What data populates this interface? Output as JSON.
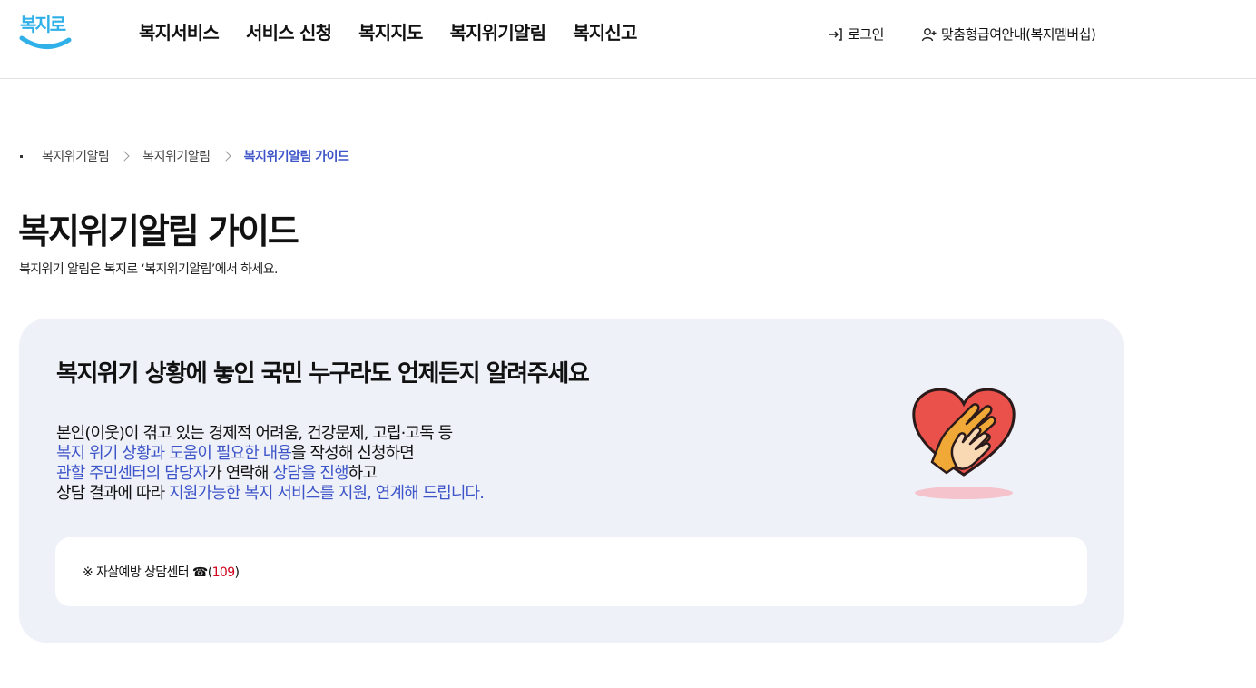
{
  "header": {
    "logo_text": "복지로",
    "nav": [
      {
        "label": "복지서비스"
      },
      {
        "label": "서비스 신청"
      },
      {
        "label": "복지지도"
      },
      {
        "label": "복지위기알림"
      },
      {
        "label": "복지신고"
      }
    ],
    "login_label": "로그인",
    "member_label": "맞춤형급여안내(복지멤버십)"
  },
  "breadcrumb": {
    "items": [
      "복지위기알림",
      "복지위기알림",
      "복지위기알림 가이드"
    ]
  },
  "page": {
    "title": "복지위기알림 가이드",
    "subtitle": "복지위기 알림은 복지로 ‘복지위기알림’에서 하세요."
  },
  "info": {
    "heading": "복지위기 상황에 놓인 국민 누구라도 언제든지 알려주세요",
    "line1": "본인(이웃)이 겪고 있는 경제적 어려움, 건강문제, 고립·고독 등",
    "line2_hl": "복지 위기 상황과 도움이 필요한 내용",
    "line2_rest": "을 작성해 신청하면",
    "line3_hl": "관할 주민센터의 담당자",
    "line3_mid": "가 연락해 ",
    "line3_hl2": "상담을 진행",
    "line3_rest": "하고",
    "line4_pre": "상담 결과에 따라 ",
    "line4_hl": "지원가능한 복지 서비스를 지원, 연계해 드립니다.",
    "heart_icon": "helping-hands-heart-icon"
  },
  "notice": {
    "prefix": "※ 자살예방 상담센터 ☎(",
    "phone": "109",
    "suffix": ")"
  },
  "colors": {
    "accent": "#3d55c8",
    "box_bg": "#eff1f9",
    "phone": "#d0021b",
    "logo_blue": "#2fb0e8"
  }
}
